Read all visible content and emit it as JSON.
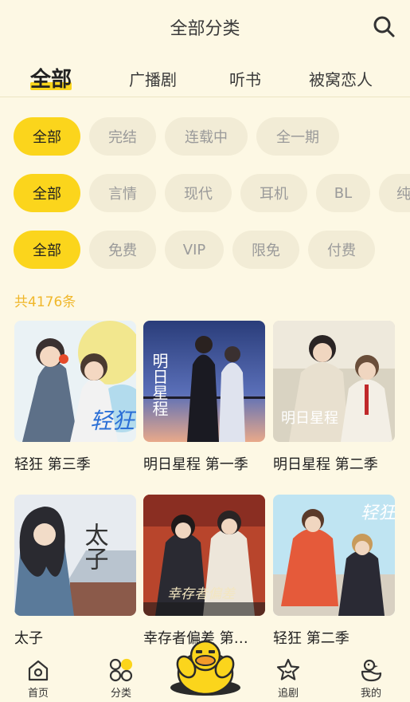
{
  "header": {
    "title": "全部分类"
  },
  "tabs": [
    {
      "label": "全部",
      "active": true
    },
    {
      "label": "广播剧",
      "active": false
    },
    {
      "label": "听书",
      "active": false
    },
    {
      "label": "被窝恋人",
      "active": false
    }
  ],
  "filters": {
    "status": [
      "全部",
      "完结",
      "连载中",
      "全一期"
    ],
    "genre": [
      "全部",
      "言情",
      "现代",
      "耳机",
      "BL",
      "纯"
    ],
    "price": [
      "全部",
      "免费",
      "VIP",
      "限免",
      "付费"
    ]
  },
  "count_text": "共4176条",
  "items": [
    {
      "title": "轻狂 第三季",
      "cover_text": "轻狂"
    },
    {
      "title": "明日星程 第一季",
      "cover_text": "明日星程"
    },
    {
      "title": "明日星程 第二季",
      "cover_text": "明日星程"
    },
    {
      "title": "太子",
      "cover_text": "太子"
    },
    {
      "title": "幸存者偏差 第…",
      "cover_text": "幸存者偏差"
    },
    {
      "title": "轻狂 第二季",
      "cover_text": "轻狂"
    }
  ],
  "bottom_nav": [
    {
      "label": "首页",
      "icon": "home-icon"
    },
    {
      "label": "分类",
      "icon": "category-icon"
    },
    {
      "label": "",
      "icon": "duck-mascot-icon"
    },
    {
      "label": "追剧",
      "icon": "star-icon"
    },
    {
      "label": "我的",
      "icon": "duck-profile-icon"
    }
  ],
  "colors": {
    "accent": "#fbd51c",
    "background": "#fdf8e4",
    "count": "#f0b72a",
    "chip": "#f2ecd6"
  }
}
